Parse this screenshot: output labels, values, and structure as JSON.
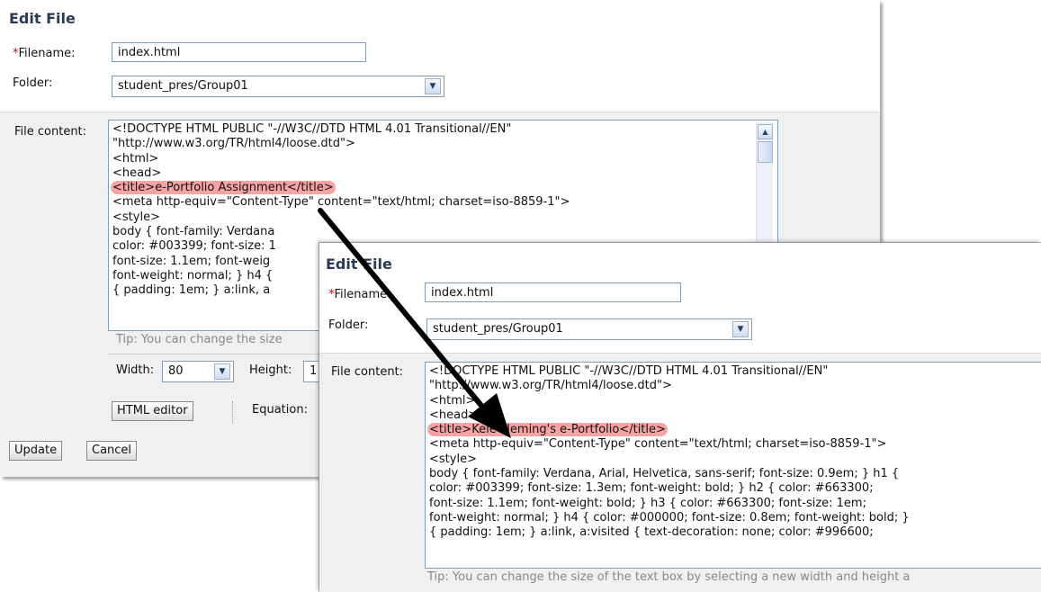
{
  "back_panel": {
    "heading": "Edit File",
    "filename_label": "Filename:",
    "filename_value": "index.html",
    "folder_label": "Folder:",
    "folder_value": "student_pres/Group01",
    "content_label": "File content:",
    "content_lines": [
      "<!DOCTYPE HTML PUBLIC \"-//W3C//DTD HTML 4.01 Transitional//EN\"",
      "\"http://www.w3.org/TR/html4/loose.dtd\">",
      "<html>",
      "<head>",
      "<title>e-Portfolio Assignment</title>",
      "<meta http-equiv=\"Content-Type\" content=\"text/html; charset=iso-8859-1\">",
      "<style>",
      "body { font-family: Verdana",
      "color: #003399; font-size: 1",
      "font-size: 1.1em; font-weig",
      "font-weight: normal; } h4 {",
      "{ padding: 1em; } a:link, a"
    ],
    "tip": "Tip: You can change the size",
    "width_label": "Width:",
    "width_value": "80",
    "height_label": "Height:",
    "height_value": "1",
    "html_editor_button": "HTML editor",
    "equation_label": "Equation:",
    "update_button": "Update",
    "cancel_button": "Cancel"
  },
  "front_panel": {
    "heading": "Edit File",
    "filename_label": "Filename:",
    "filename_value": "index.html",
    "folder_label": "Folder:",
    "folder_value": "student_pres/Group01",
    "content_label": "File content:",
    "content_lines": [
      "<!DOCTYPE HTML PUBLIC \"-//W3C//DTD HTML 4.01 Transitional//EN\"",
      "\"http://www.w3.org/TR/html4/loose.dtd\">",
      "<html>",
      "<head>",
      "<title>Kele Fleming's e-Portfolio</title>",
      "<meta http-equiv=\"Content-Type\" content=\"text/html; charset=iso-8859-1\">",
      "<style>",
      "body { font-family: Verdana, Arial, Helvetica, sans-serif; font-size: 0.9em; } h1 {",
      "color: #003399; font-size: 1.3em; font-weight: bold; } h2 { color: #663300;",
      "font-size: 1.1em; font-weight: bold; } h3 { color: #663300; font-size: 1em;",
      "font-weight: normal; } h4 { color: #000000; font-size: 0.8em; font-weight: bold; }",
      "{ padding: 1em; } a:link, a:visited { text-decoration: none; color: #996600;"
    ],
    "tip": "Tip: You can change the size of the text box by selecting a new width and height a"
  },
  "required_mark": "*",
  "colors": {
    "heading": "#2a3a55",
    "required": "#d40000",
    "highlight": "#f6a3a3",
    "arrow": "#000000"
  }
}
